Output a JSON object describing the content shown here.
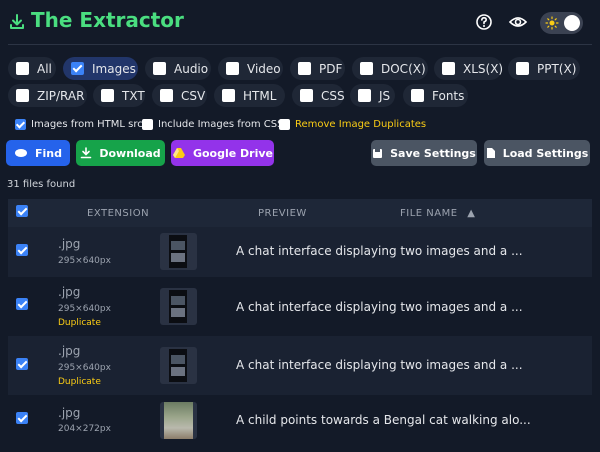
{
  "app": {
    "title": "The Extractor",
    "brand_color": "#4ade80"
  },
  "header_icons": [
    "help-circle-icon",
    "eye-icon",
    "sun-icon"
  ],
  "filters": [
    {
      "label": "All",
      "checked": false
    },
    {
      "label": "Images",
      "checked": true
    },
    {
      "label": "Audio",
      "checked": false
    },
    {
      "label": "Video",
      "checked": false
    },
    {
      "label": "PDF",
      "checked": false
    },
    {
      "label": "DOC(X)",
      "checked": false
    },
    {
      "label": "XLS(X)",
      "checked": false
    },
    {
      "label": "PPT(X)",
      "checked": false
    },
    {
      "label": "ZIP/RAR",
      "checked": false
    },
    {
      "label": "TXT",
      "checked": false
    },
    {
      "label": "CSV",
      "checked": false
    },
    {
      "label": "HTML",
      "checked": false
    },
    {
      "label": "CSS",
      "checked": false
    },
    {
      "label": "JS",
      "checked": false
    },
    {
      "label": "Fonts",
      "checked": false
    }
  ],
  "options": [
    {
      "label": "Images from HTML src",
      "checked": true
    },
    {
      "label": "Include Images from CSS",
      "checked": false
    },
    {
      "label": "Remove Image Duplicates",
      "checked": false
    }
  ],
  "actions": {
    "find": "Find",
    "download": "Download",
    "drive": "Google Drive",
    "save": "Save Settings",
    "load": "Load Settings"
  },
  "status": {
    "files_found": "31 files found"
  },
  "table": {
    "headers": {
      "extension": "EXTENSION",
      "preview": "PREVIEW",
      "file_name": "FILE NAME",
      "sort_indicator": "▲"
    },
    "rows": [
      {
        "ext": ".jpg",
        "dims": "295×640px",
        "tag": "",
        "name": "A chat interface displaying two images and a ...",
        "thumb": "phone"
      },
      {
        "ext": ".jpg",
        "dims": "295×640px",
        "tag": "Duplicate",
        "name": "A chat interface displaying two images and a ...",
        "thumb": "phone"
      },
      {
        "ext": ".jpg",
        "dims": "295×640px",
        "tag": "Duplicate",
        "name": "A chat interface displaying two images and a ...",
        "thumb": "phone"
      },
      {
        "ext": ".jpg",
        "dims": "204×272px",
        "tag": "",
        "name": "A child points towards a Bengal cat walking alo...",
        "thumb": "cat"
      }
    ]
  },
  "colors": {
    "find": "#2563eb",
    "download": "#16a34a",
    "drive": "#9333ea",
    "settings": "#4b5563",
    "duplicate": "#facc15"
  }
}
